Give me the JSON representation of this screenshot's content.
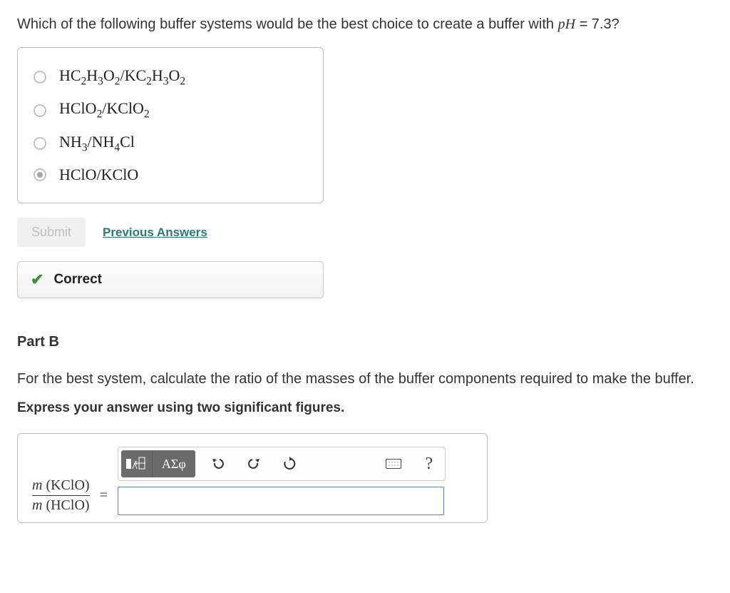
{
  "partA": {
    "question_prefix": "Which of the following buffer systems would be the best choice to create a buffer with ",
    "ph_label": "pH",
    "ph_value": " = 7.3?",
    "options": [
      "HC₂H₃O₂ / KC₂H₃O₂",
      "HClO₂ / KClO₂",
      "NH₃ / NH₄Cl",
      "HClO / KClO"
    ],
    "selected_index": 3,
    "submit_label": "Submit",
    "previous_label": "Previous Answers",
    "feedback": "Correct"
  },
  "partB": {
    "label": "Part B",
    "question": "For the best system, calculate the ratio of the masses of the buffer components required to make the buffer.",
    "instruction": "Express your answer using two significant figures.",
    "ratio_num": "m (KClO)",
    "ratio_den": "m (HClO)",
    "eq": "=",
    "toolbar": {
      "templates": "▮√▯",
      "greek": "ΑΣφ",
      "undo": "↶",
      "redo": "↷",
      "reset": "↻",
      "keyboard": "kbd",
      "help": "?"
    },
    "input_value": ""
  }
}
